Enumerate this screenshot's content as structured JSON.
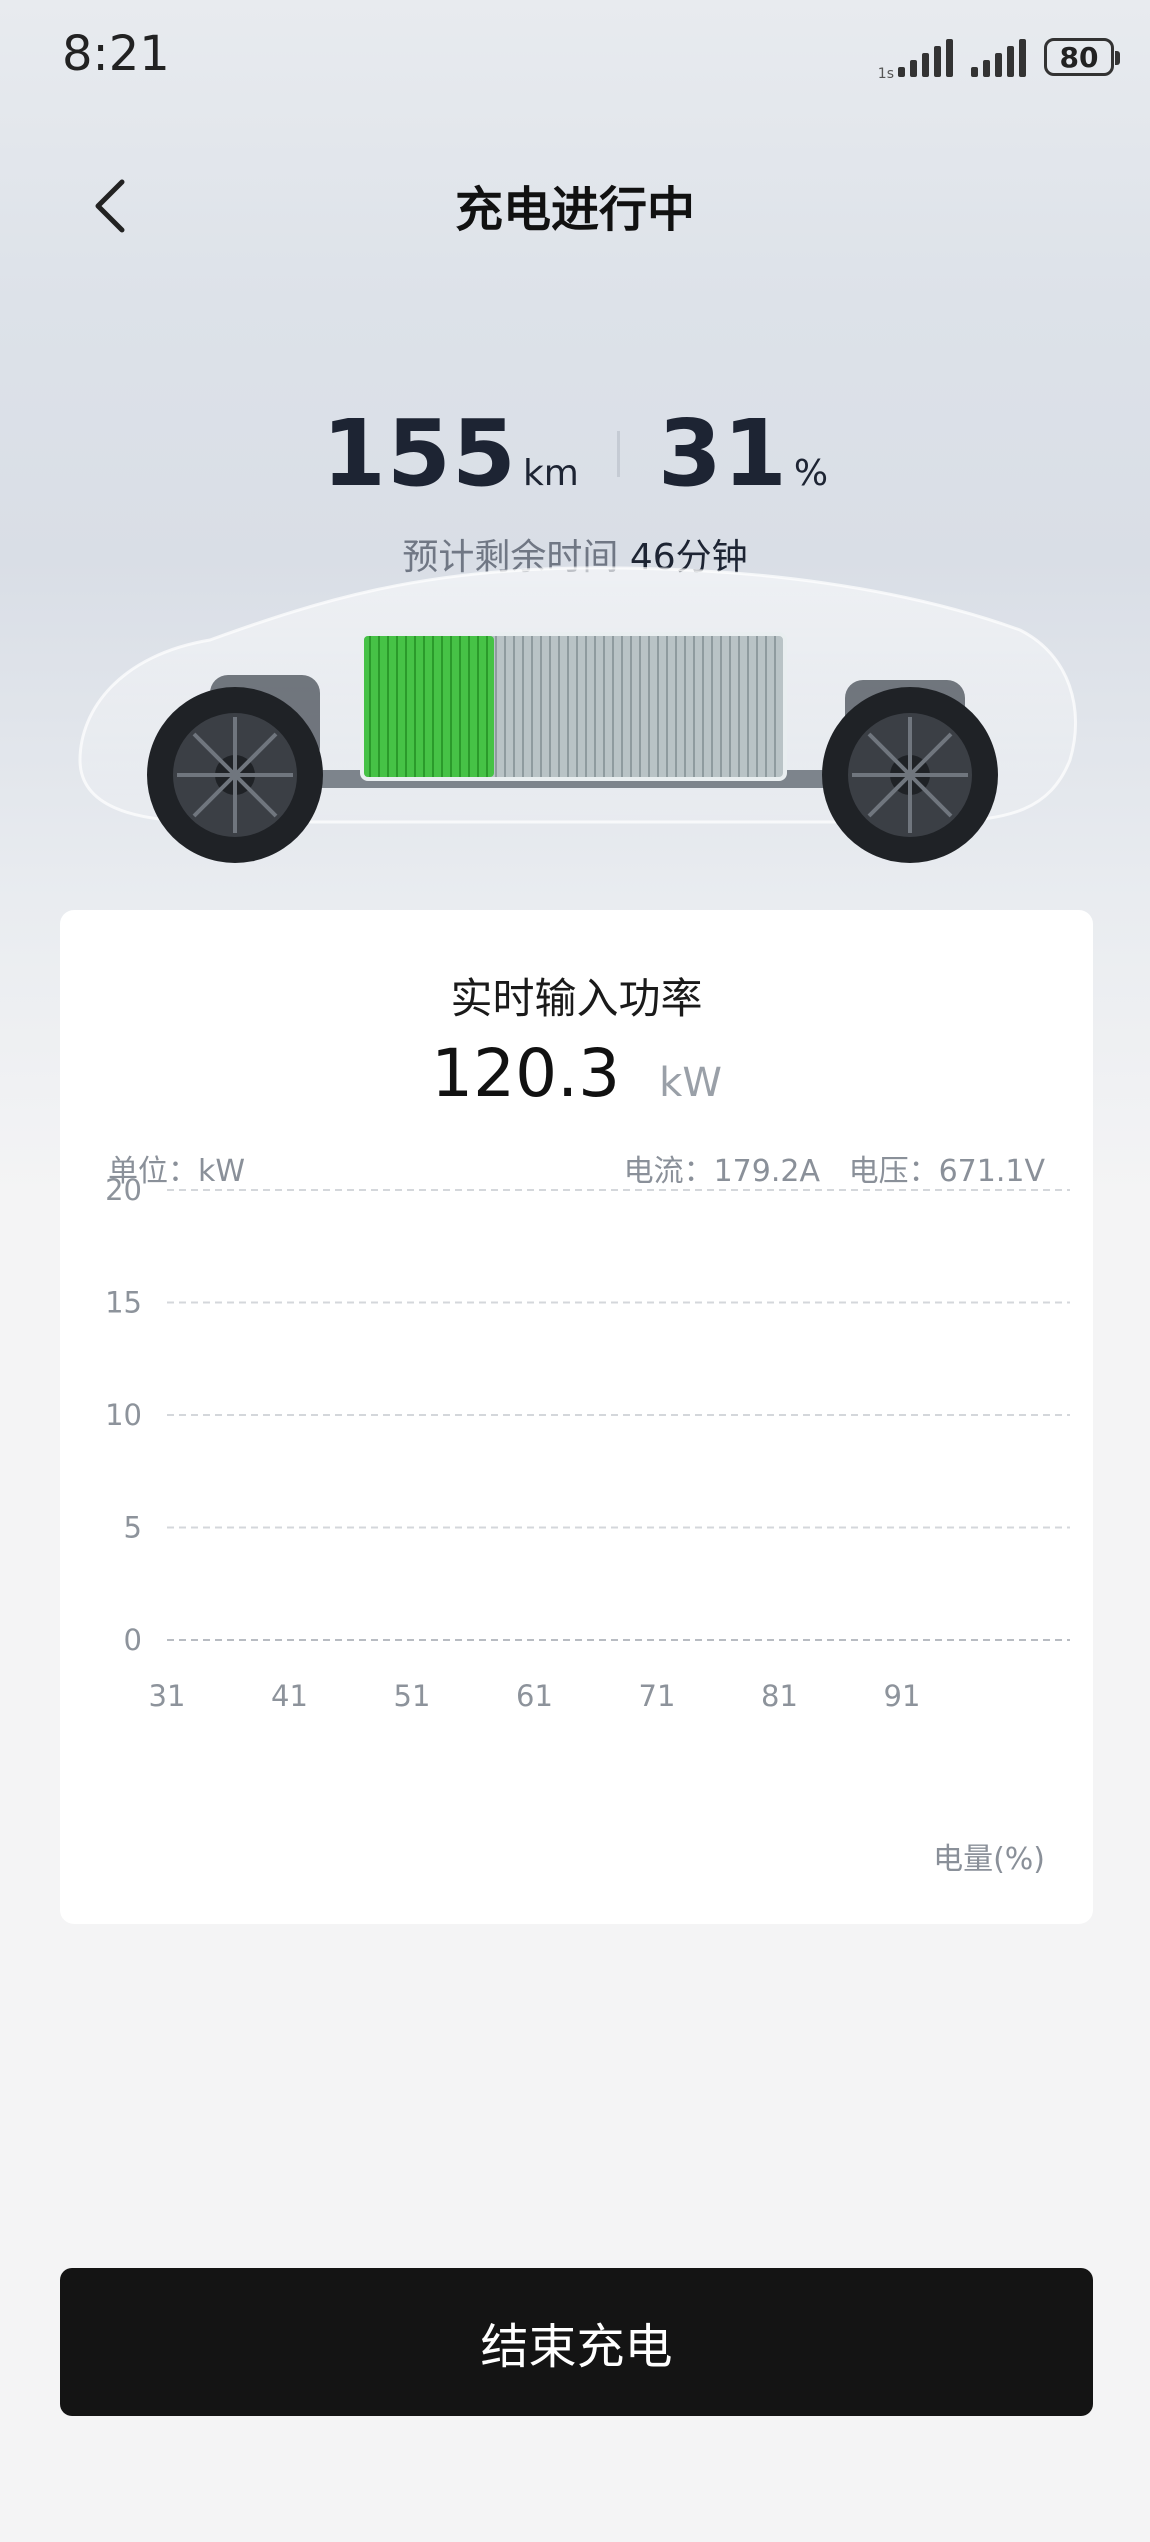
{
  "status_bar": {
    "time": "8:21",
    "signal_tag": "1s",
    "battery_level": "80"
  },
  "header": {
    "title": "充电进行中",
    "back_icon": "chevron-left-icon"
  },
  "stats": {
    "range_value": "155",
    "range_unit": "km",
    "soc_value": "31",
    "soc_unit": "%",
    "remaining_label": "预计剩余时间",
    "remaining_value": "46分钟",
    "battery_fill_fraction": 0.31,
    "battery_fill_color": "#3fbf3f"
  },
  "power_card": {
    "title": "实时输入功率",
    "power_value": "120.3",
    "power_unit": "kW",
    "unit_label": "单位：kW",
    "current_label": "电流：179.2A",
    "voltage_label": "电压：671.1V",
    "x_axis_label": "电量(%)"
  },
  "chart_data": {
    "type": "line",
    "title": "实时输入功率",
    "ylabel": "单位：kW",
    "xlabel": "电量(%)",
    "ylim": [
      0,
      20
    ],
    "xlim": [
      31,
      100
    ],
    "y_ticks": [
      "0",
      "5",
      "10",
      "15",
      "20"
    ],
    "x_ticks": [
      "31",
      "41",
      "51",
      "61",
      "71",
      "81",
      "91"
    ],
    "grid": true,
    "series": []
  },
  "actions": {
    "end_charging_label": "结束充电"
  },
  "colors": {
    "button_bg": "#141414",
    "accent_green": "#3fbf3f"
  }
}
